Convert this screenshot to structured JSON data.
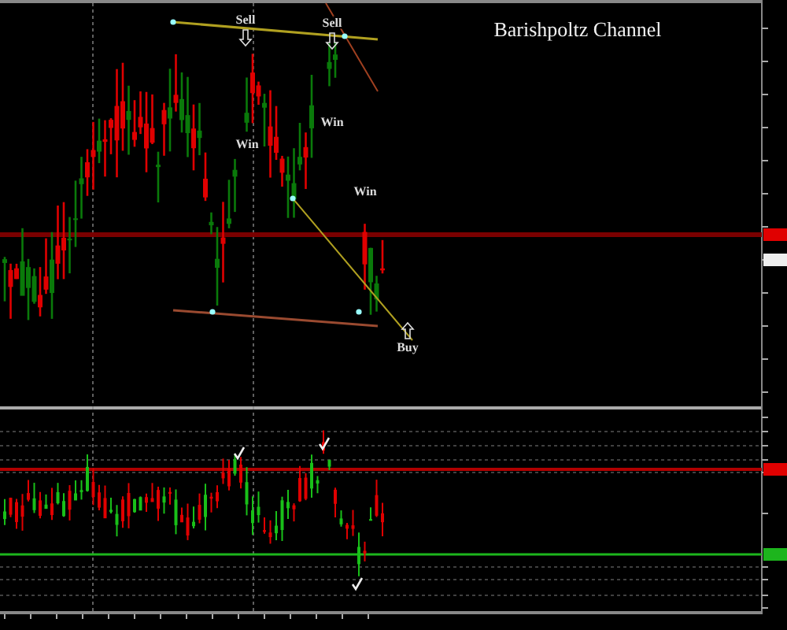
{
  "chart_title": "Barishpoltz Channel",
  "signals": [
    {
      "kind": "sell",
      "label": "Sell"
    },
    {
      "kind": "sell",
      "label": "Sell"
    },
    {
      "kind": "win",
      "label": "Win"
    },
    {
      "kind": "win",
      "label": "Win"
    },
    {
      "kind": "win",
      "label": "Win"
    },
    {
      "kind": "buy",
      "label": "Buy"
    }
  ]
}
